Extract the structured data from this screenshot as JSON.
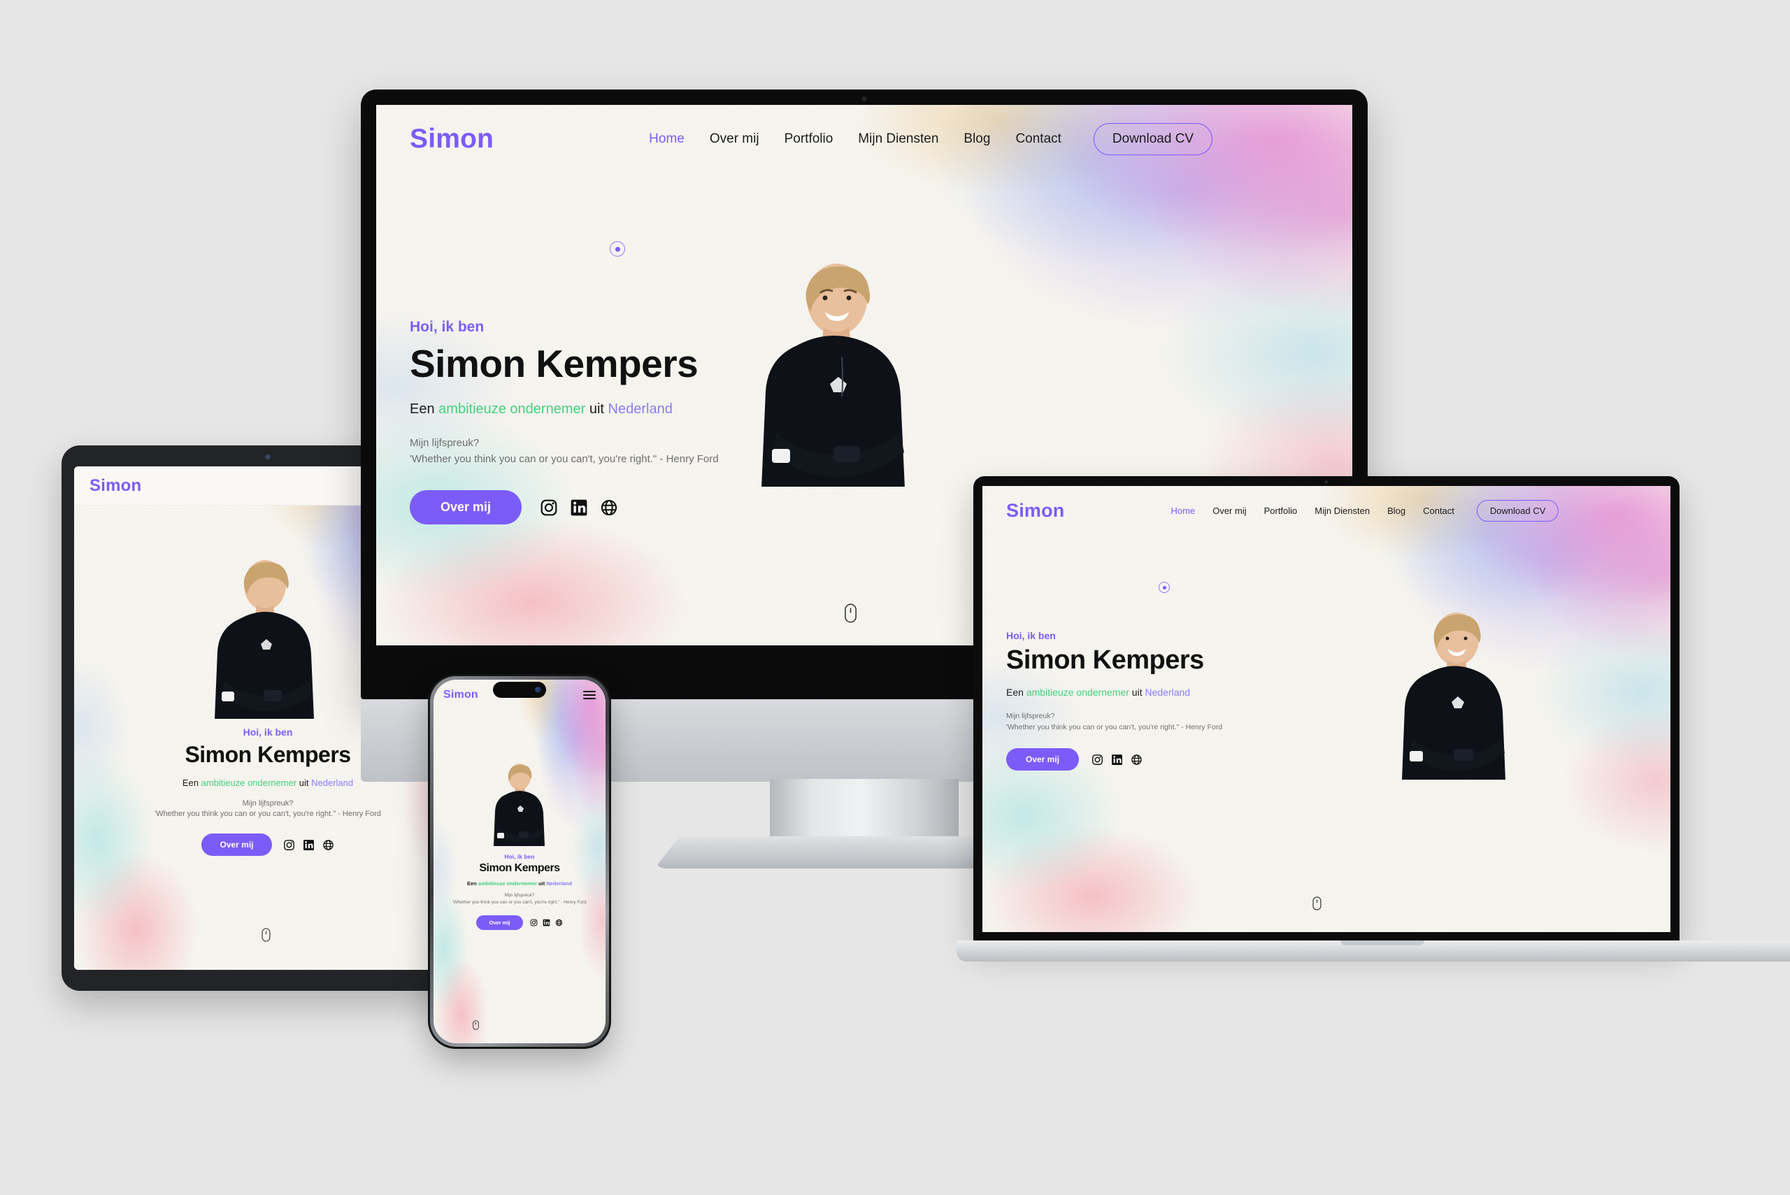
{
  "brand": {
    "logo": "Simon",
    "accent_purple": "#7c5cf8",
    "accent_green": "#45d07d",
    "page_background": "#e6e6e6",
    "site_background": "#f7f5f0"
  },
  "nav": {
    "items": [
      {
        "label": "Home",
        "active": true
      },
      {
        "label": "Over mij",
        "active": false
      },
      {
        "label": "Portfolio",
        "active": false
      },
      {
        "label": "Mijn Diensten",
        "active": false
      },
      {
        "label": "Blog",
        "active": false
      },
      {
        "label": "Contact",
        "active": false
      }
    ],
    "cta_label": "Download CV",
    "menu_icon": "hamburger-icon"
  },
  "hero": {
    "eyebrow": "Hoi, ik ben",
    "headline": "Simon Kempers",
    "subline_prefix": "Een ",
    "subline_role": "ambitieuze ondernemer",
    "subline_middle": " uit ",
    "subline_country": "Nederland",
    "quote_label": "Mijn lijfspreuk?",
    "quote_text": "'Whether you think you can or you can't, you're right.\" - Henry Ford",
    "cta_label": "Over mij",
    "socials": [
      {
        "name": "instagram-icon",
        "label": "Instagram"
      },
      {
        "name": "linkedin-icon",
        "label": "LinkedIn"
      },
      {
        "name": "website-globe-icon",
        "label": "Website"
      }
    ],
    "scroll_icon": "scroll-mouse-icon",
    "cursor_icon": "cursor-dot-icon",
    "portrait_alt": "Simon Kempers portrait"
  },
  "devices": [
    {
      "name": "imac",
      "label": "iMac desktop mockup"
    },
    {
      "name": "macbook",
      "label": "MacBook laptop mockup"
    },
    {
      "name": "tablet",
      "label": "Tablet mockup"
    },
    {
      "name": "phone",
      "label": "Smartphone mockup"
    }
  ]
}
